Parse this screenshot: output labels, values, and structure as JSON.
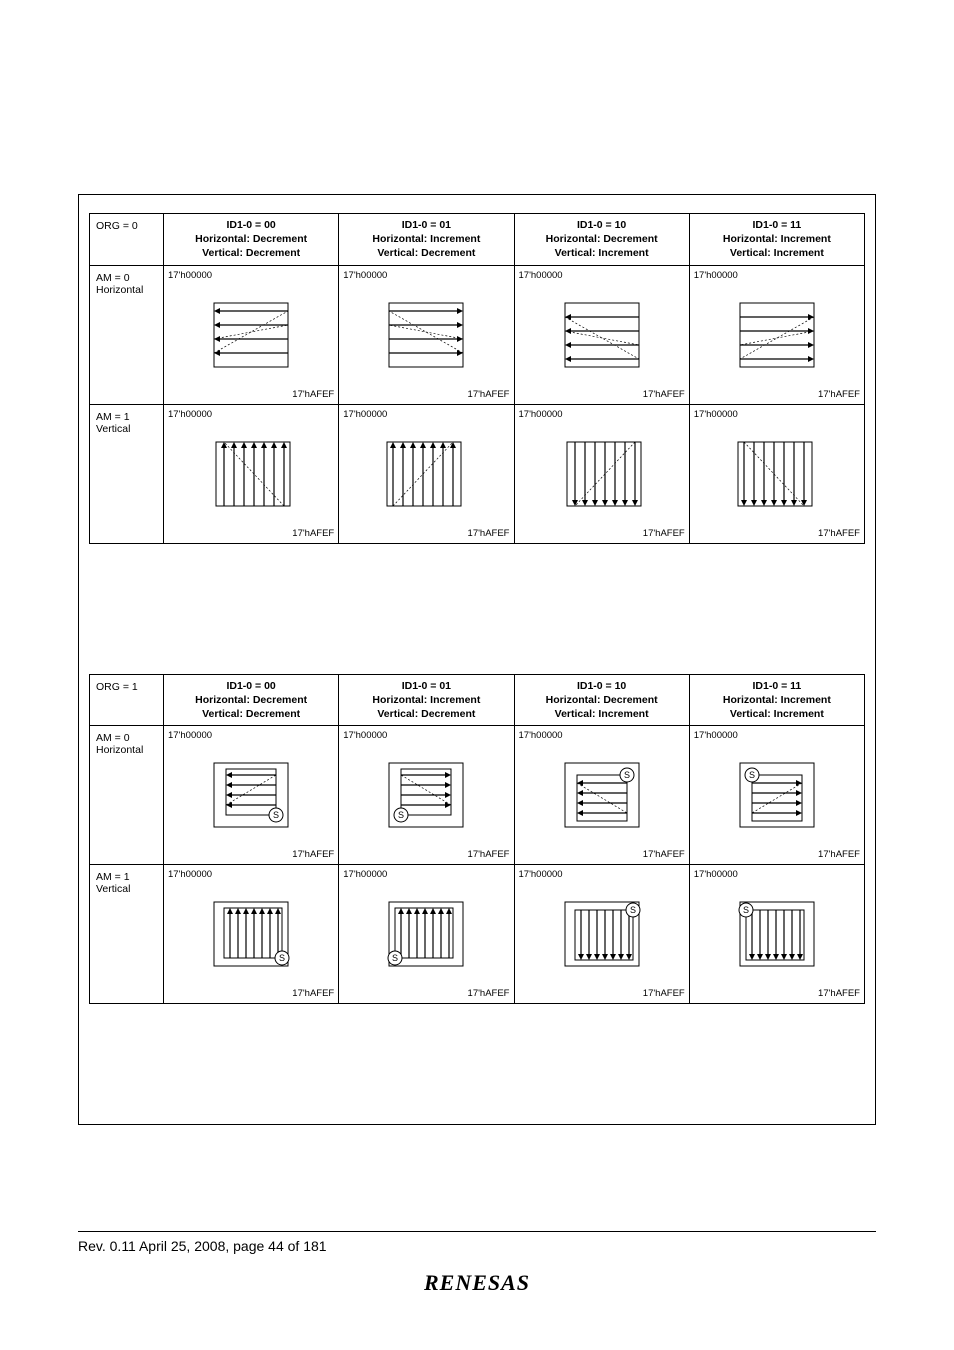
{
  "addr_start": "17'h00000",
  "addr_end": "17'hAFEF",
  "columns": [
    {
      "title": "ID1-0 = 00",
      "h": "Horizontal: Decrement",
      "v": "Vertical: Decrement"
    },
    {
      "title": "ID1-0 = 01",
      "h": "Horizontal: Increment",
      "v": "Vertical: Decrement"
    },
    {
      "title": "ID1-0 = 10",
      "h": "Horizontal: Decrement",
      "v": "Vertical: Increment"
    },
    {
      "title": "ID1-0 = 11",
      "h": "Horizontal: Increment",
      "v": "Vertical: Increment"
    }
  ],
  "blocks": [
    {
      "corner": "ORG = 0",
      "rows": [
        {
          "head_l1": "AM = 0",
          "head_l2": "Horizontal"
        },
        {
          "head_l1": "AM = 1",
          "head_l2": "Vertical"
        }
      ]
    },
    {
      "corner": "ORG = 1",
      "rows": [
        {
          "head_l1": "AM = 0",
          "head_l2": "Horizontal"
        },
        {
          "head_l1": "AM = 1",
          "head_l2": "Vertical"
        }
      ]
    }
  ],
  "s_label": "S",
  "footer": {
    "rev": "Rev. 0.11 April 25, 2008, page 44 of 181",
    "logo": "RENESAS"
  }
}
